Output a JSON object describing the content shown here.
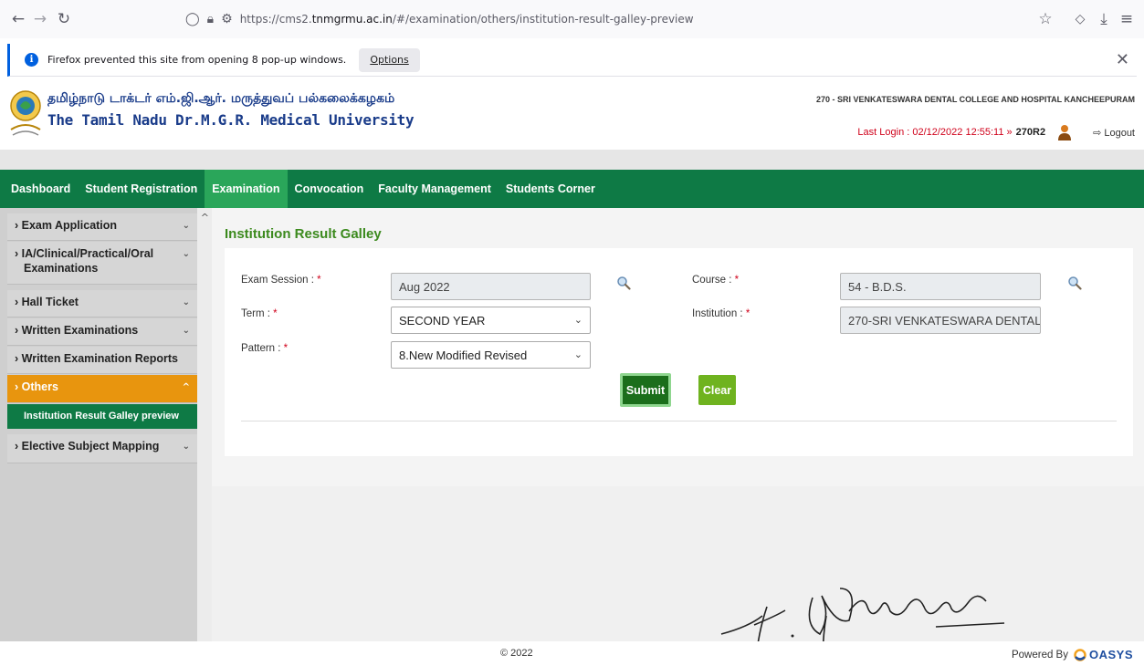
{
  "browser": {
    "url_prefix": "https://cms2.",
    "url_domain": "tnmgrmu.ac.in",
    "url_path": "/#/examination/others/institution-result-galley-preview"
  },
  "popup": {
    "message": "Firefox prevented this site from opening 8 pop-up windows.",
    "options_label": "Options"
  },
  "header": {
    "university_tamil": "தமிழ்நாடு டாக்டர் எம்.ஜி.ஆர். மருத்துவப் பல்கலைக்கழகம்",
    "university_english": "The Tamil Nadu Dr.M.G.R. Medical University",
    "college_name": "270 - SRI VENKATESWARA DENTAL COLLEGE AND HOSPITAL KANCHEEPURAM",
    "last_login": "Last Login : 02/12/2022 12:55:11 »",
    "username": "270R2",
    "logout_label": "Logout"
  },
  "nav": {
    "items": [
      {
        "label": "Dashboard"
      },
      {
        "label": "Student Registration"
      },
      {
        "label": "Examination"
      },
      {
        "label": "Convocation"
      },
      {
        "label": "Faculty Management"
      },
      {
        "label": "Students Corner"
      }
    ]
  },
  "sidebar": {
    "items": [
      {
        "label": "› Exam Application"
      },
      {
        "label": "› IA/Clinical/Practical/Oral"
      },
      {
        "label": "Examinations"
      },
      {
        "label": "› Hall Ticket"
      },
      {
        "label": "› Written Examinations"
      },
      {
        "label": "› Written Examination Reports"
      },
      {
        "label": "› Others"
      },
      {
        "label": "Institution Result Galley preview"
      },
      {
        "label": "› Elective Subject Mapping"
      }
    ]
  },
  "page": {
    "title": "Institution Result Galley"
  },
  "form": {
    "exam_session_label": "Exam Session : ",
    "exam_session_value": "Aug 2022",
    "course_label": "Course : ",
    "course_value": "54 - B.D.S.",
    "term_label": "Term : ",
    "term_value": "SECOND YEAR",
    "institution_label": "Institution : ",
    "institution_value": "270-SRI VENKATESWARA DENTAL",
    "pattern_label": "Pattern : ",
    "pattern_value": "8.New Modified Revised",
    "required_mark": "*",
    "submit_label": "Submit",
    "clear_label": "Clear"
  },
  "footer": {
    "copyright": "© 2022",
    "powered_by": "Powered By",
    "brand": "OASYS"
  },
  "colors": {
    "nav_green": "#0e7a45",
    "nav_active": "#2aa65a",
    "sidebar_active": "#e8950e",
    "title_green": "#3c8a1e",
    "required_red": "#d0021b"
  }
}
